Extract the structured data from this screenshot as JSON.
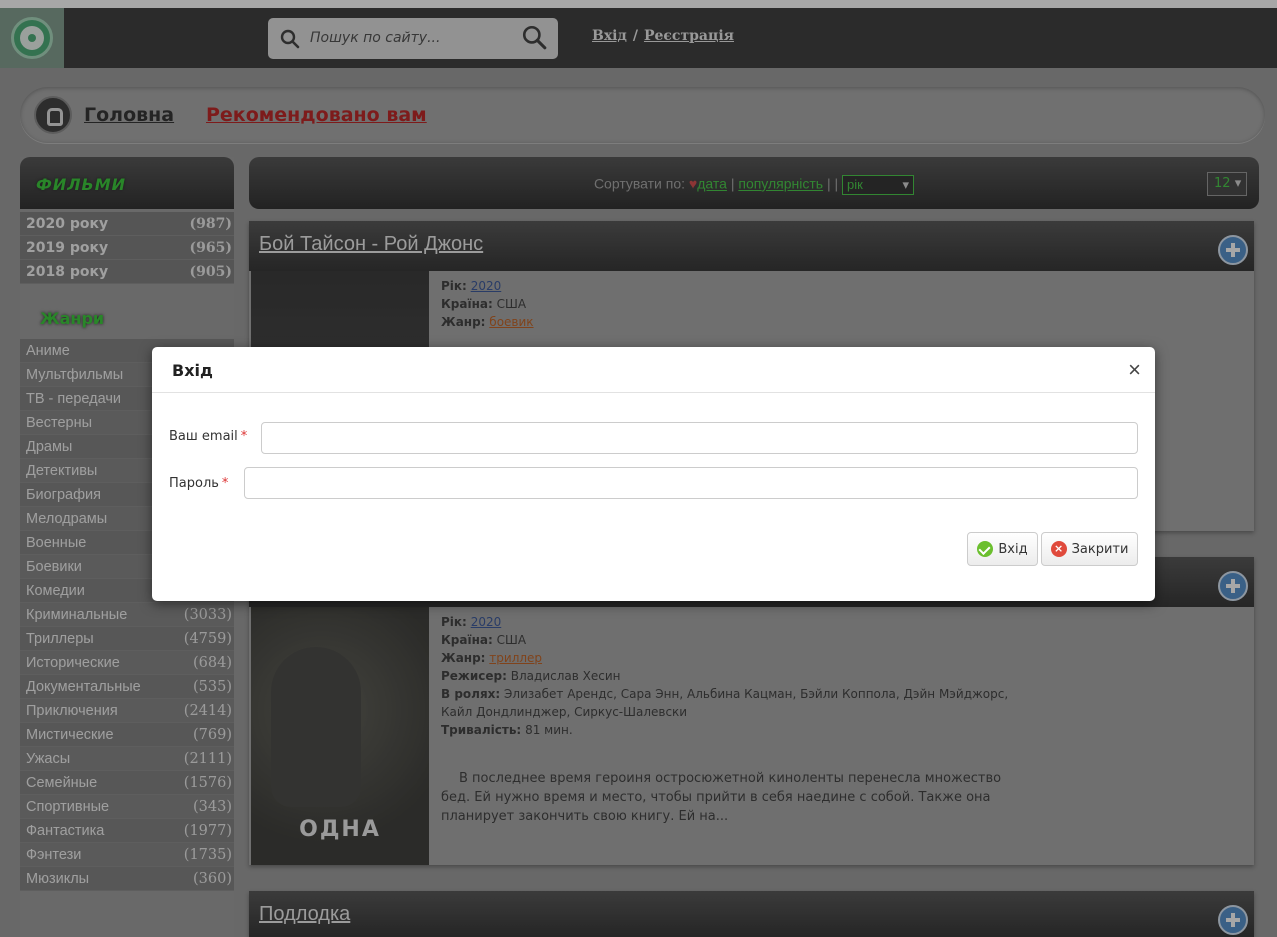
{
  "header": {
    "search_placeholder": "Пошук по сайту...",
    "login_label": "Вхід",
    "separator": "/",
    "register_label": "Реєстрація"
  },
  "breadcrumb": {
    "home": "Головна",
    "current": "Рекомендовано вам"
  },
  "sidebar": {
    "films_title": "ФИЛЬМИ",
    "years": [
      {
        "label": "2020 року",
        "count": "(987)"
      },
      {
        "label": "2019 року",
        "count": "(965)"
      },
      {
        "label": "2018 року",
        "count": "(905)"
      }
    ],
    "genres_title": "Жанри",
    "genres": [
      {
        "label": "Аниме",
        "count": ""
      },
      {
        "label": "Мультфильмы",
        "count": ""
      },
      {
        "label": "ТВ - передачи",
        "count": ""
      },
      {
        "label": "Вестерны",
        "count": ""
      },
      {
        "label": "Драмы",
        "count": ""
      },
      {
        "label": "Детективы",
        "count": ""
      },
      {
        "label": "Биография",
        "count": ""
      },
      {
        "label": "Мелодрамы",
        "count": ""
      },
      {
        "label": "Военные",
        "count": ""
      },
      {
        "label": "Боевики",
        "count": ""
      },
      {
        "label": "Комедии",
        "count": ""
      },
      {
        "label": "Криминальные",
        "count": "(3033)"
      },
      {
        "label": "Триллеры",
        "count": "(4759)"
      },
      {
        "label": "Исторические",
        "count": "(684)"
      },
      {
        "label": "Документальные",
        "count": "(535)"
      },
      {
        "label": "Приключения",
        "count": "(2414)"
      },
      {
        "label": "Мистические",
        "count": "(769)"
      },
      {
        "label": "Ужасы",
        "count": "(2111)"
      },
      {
        "label": "Семейные",
        "count": "(1576)"
      },
      {
        "label": "Спортивные",
        "count": "(343)"
      },
      {
        "label": "Фантастика",
        "count": "(1977)"
      },
      {
        "label": "Фэнтези",
        "count": "(1735)"
      },
      {
        "label": "Мюзиклы",
        "count": "(360)"
      }
    ]
  },
  "sortbar": {
    "prefix": "Сортувати по:",
    "date": "дата",
    "sep1": "|",
    "popularity": "популярність",
    "sep2": "| |",
    "year_select": "рік",
    "per_page": "12"
  },
  "movies": [
    {
      "title": "Бой Тайсон - Рой Джонс",
      "year_label": "Рік:",
      "year": "2020",
      "country_label": "Країна:",
      "country": "США",
      "genre_label": "Жанр:",
      "genre": "боевик"
    },
    {
      "title": "",
      "year_label": "Рік:",
      "year": "2020",
      "country_label": "Країна:",
      "country": "США",
      "genre_label": "Жанр:",
      "genre": "триллер",
      "director_label": "Режисер:",
      "director": "Владислав Хесин",
      "cast_label": "В ролях:",
      "cast_line1": "Элизабет Арендс, Сара Энн, Альбина Кацман, Бэйли Коппола, Дэйн Мэйджорс,",
      "cast_line2": "Кайл Дондлинджер, Сиркус-Шалевски",
      "duration_label": "Тривалість:",
      "duration": "81 мин.",
      "description": "В последнее время героиня остросюжетной киноленты перенесла множество бед. Ей нужно время и место, чтобы прийти в себя наедине с собой. Также она планирует закончить свою книгу. Ей на...",
      "poster_text": "ОДНА"
    },
    {
      "title": "Подлодка"
    }
  ],
  "modal": {
    "title": "Вхід",
    "close": "×",
    "email_label": "Ваш email",
    "password_label": "Пароль",
    "required_mark": "*",
    "submit_label": "Вхід",
    "close_label": "Закрити"
  }
}
